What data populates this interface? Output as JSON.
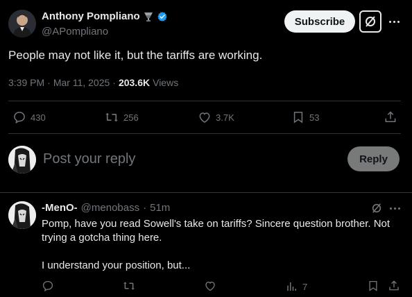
{
  "post": {
    "author_name": "Anthony Pompliano",
    "author_handle": "@APompliano",
    "subscribe_label": "Subscribe",
    "text": "People may not like it, but the tariffs are working.",
    "time": "3:39 PM",
    "date_sep": "·",
    "date": "Mar 11, 2025",
    "views_sep": "·",
    "views_count": "203.6K",
    "views_label": "Views",
    "replies": "430",
    "reposts": "256",
    "likes": "3.7K",
    "bookmarks": "53"
  },
  "composer": {
    "placeholder": "Post your reply",
    "reply_label": "Reply"
  },
  "reply": {
    "author_name": "-MenO-",
    "author_handle": "@menobass",
    "time_sep": "·",
    "time": "51m",
    "line1": "Pomp, have you read Sowell's take on tariffs? Sincere question brother. Not",
    "line2": "trying a gotcha thing here.",
    "line3": "I understand your position, but...",
    "views": "7"
  },
  "colors": {
    "background": "#000000",
    "text": "#e7e9ea",
    "muted": "#71767b",
    "verified": "#1d9bf0",
    "divider": "#2f3336"
  }
}
